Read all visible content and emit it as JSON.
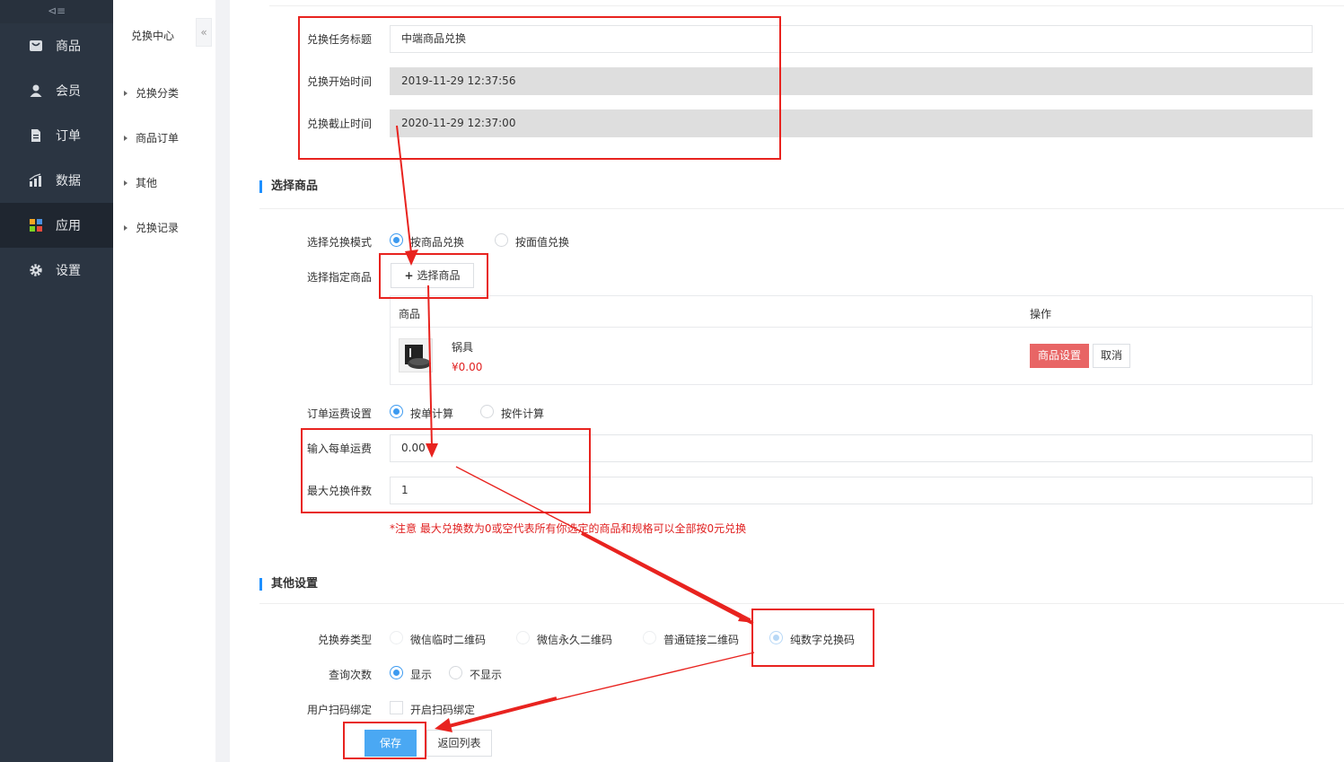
{
  "nav": {
    "toggle": "⊲≡",
    "items": [
      {
        "label": "商品",
        "icon": "product-icon"
      },
      {
        "label": "会员",
        "icon": "user-icon"
      },
      {
        "label": "订单",
        "icon": "order-icon"
      },
      {
        "label": "数据",
        "icon": "chart-icon"
      },
      {
        "label": "应用",
        "icon": "apps-icon"
      },
      {
        "label": "设置",
        "icon": "gear-icon"
      }
    ]
  },
  "subnav": {
    "title": "兑换中心",
    "collapse": "«",
    "items": [
      "兑换分类",
      "商品订单",
      "其他",
      "兑换记录"
    ]
  },
  "form": {
    "title_label": "兑换任务标题",
    "title_value": "中端商品兑换",
    "start_label": "兑换开始时间",
    "start_value": "2019-11-29 12:37:56",
    "end_label": "兑换截止时间",
    "end_value": "2020-11-29 12:37:00"
  },
  "select_goods": {
    "section_title": "选择商品",
    "mode_label": "选择兑换模式",
    "mode_options": [
      "按商品兑换",
      "按面值兑换"
    ],
    "goods_label": "选择指定商品",
    "select_button": "选择商品",
    "table_headers": [
      "商品",
      "操作"
    ],
    "goods": {
      "name": "锅具",
      "price": "¥0.00"
    },
    "settings_button": "商品设置",
    "cancel_button": "取消",
    "freight_label": "订单运费设置",
    "freight_options": [
      "按单计算",
      "按件计算"
    ],
    "freight_input_label": "输入每单运费",
    "freight_value": "0.00",
    "max_label": "最大兑换件数",
    "max_value": "1",
    "note": "*注意 最大兑换数为0或空代表所有你选定的商品和规格可以全部按0元兑换"
  },
  "other": {
    "section_title": "其他设置",
    "coupon_label": "兑换券类型",
    "coupon_options": [
      "微信临时二维码",
      "微信永久二维码",
      "普通链接二维码",
      "纯数字兑换码"
    ],
    "query_label": "查询次数",
    "query_options": [
      "显示",
      "不显示"
    ],
    "bind_label": "用户扫码绑定",
    "bind_option": "开启扫码绑定",
    "save_button": "保存",
    "back_button": "返回列表"
  },
  "colors": {
    "accent": "#3c9af0",
    "danger": "#e86565",
    "nav_bg": "#2b3542",
    "annotation": "#e8231f"
  }
}
